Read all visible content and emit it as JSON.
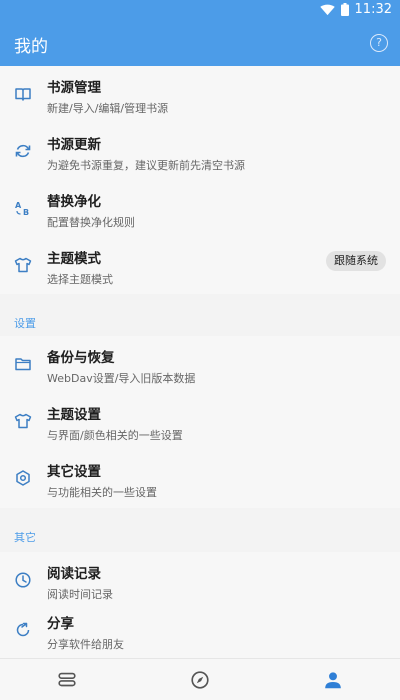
{
  "status_bar": {
    "time": "11:32",
    "icons": [
      "wifi-icon",
      "battery-icon"
    ]
  },
  "app_bar": {
    "title": "我的",
    "help_icon": "help-circle-icon",
    "help_glyph": "?"
  },
  "main_items": [
    {
      "title": "书源管理",
      "subtitle": "新建/导入/编辑/管理书源",
      "icon": "book-open-icon"
    },
    {
      "title": "书源更新",
      "subtitle": "为避免书源重复，建议更新前先清空书源",
      "icon": "sync-icon"
    },
    {
      "title": "替换净化",
      "subtitle": "配置替换净化规则",
      "icon": "replace-ab-icon"
    },
    {
      "title": "主题模式",
      "subtitle": "选择主题模式",
      "icon": "tshirt-icon",
      "chip": "跟随系统"
    }
  ],
  "settings_section": {
    "label": "设置",
    "items": [
      {
        "title": "备份与恢复",
        "subtitle": "WebDav设置/导入旧版本数据",
        "icon": "folder-icon"
      },
      {
        "title": "主题设置",
        "subtitle": "与界面/颜色相关的一些设置",
        "icon": "tshirt-icon"
      },
      {
        "title": "其它设置",
        "subtitle": "与功能相关的一些设置",
        "icon": "gear-icon"
      }
    ]
  },
  "other_section": {
    "label": "其它",
    "items": [
      {
        "title": "阅读记录",
        "subtitle": "阅读时间记录",
        "icon": "clock-icon"
      },
      {
        "title": "分享",
        "subtitle": "分享软件给朋友",
        "icon": "share-icon"
      }
    ]
  },
  "bottom_nav": [
    {
      "name": "bookshelf",
      "icon": "bookshelf-icon",
      "active": false
    },
    {
      "name": "discover",
      "icon": "compass-icon",
      "active": false
    },
    {
      "name": "my",
      "icon": "person-icon",
      "active": true
    }
  ],
  "colors": {
    "accent": "#4c9ce8",
    "icon": "#3d7fc4",
    "nav_inactive": "#555555",
    "nav_active": "#2f7fd6"
  }
}
